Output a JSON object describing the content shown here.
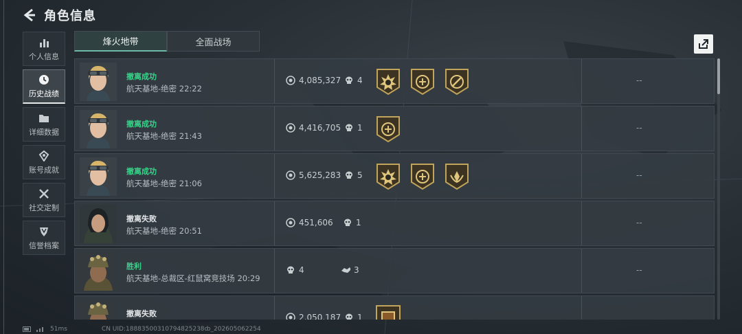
{
  "header": {
    "title": "角色信息"
  },
  "nav": [
    {
      "label": "个人信息",
      "icon": "bar-chart-icon"
    },
    {
      "label": "历史战绩",
      "icon": "clock-icon",
      "active": true
    },
    {
      "label": "详细数据",
      "icon": "folder-icon"
    },
    {
      "label": "账号成就",
      "icon": "trophy-icon"
    },
    {
      "label": "社交定制",
      "icon": "tools-icon"
    },
    {
      "label": "信誉档案",
      "icon": "shield-icon"
    }
  ],
  "tabs": [
    {
      "label": "烽火地带",
      "active": true
    },
    {
      "label": "全面战场",
      "active": false
    }
  ],
  "matches": [
    {
      "result": "撤离成功",
      "status": "ok",
      "map": "航天基地-绝密 22:22",
      "value": "4,085,327",
      "kills": "4",
      "badges": [
        "sun-badge-icon",
        "emblem-badge-icon",
        "compass-badge-icon"
      ],
      "extra": "--",
      "avatar": "female-goggles"
    },
    {
      "result": "撤离成功",
      "status": "ok",
      "map": "航天基地-绝密 21:43",
      "value": "4,416,705",
      "kills": "1",
      "badges": [
        "emblem-badge-icon"
      ],
      "extra": "--",
      "avatar": "female-goggles"
    },
    {
      "result": "撤离成功",
      "status": "ok",
      "map": "航天基地-绝密 21:06",
      "value": "5,625,283",
      "kills": "5",
      "badges": [
        "sun-badge-icon",
        "emblem-badge-icon",
        "wings-badge-icon"
      ],
      "extra": "--",
      "avatar": "female-goggles"
    },
    {
      "result": "撤离失败",
      "status": "fail",
      "map": "航天基地-绝密 20:51",
      "value": "451,606",
      "kills": "1",
      "badges": [],
      "extra": "--",
      "avatar": "female-hood"
    },
    {
      "result": "胜利",
      "status": "ok",
      "map": "航天基地-总裁区-红鼠窝竞技场 20:29",
      "kills": "4",
      "assists": "3",
      "badges": [],
      "extra": "--",
      "avatar": "male-helmet",
      "mode": "arena"
    },
    {
      "result": "撤离失败",
      "status": "fail",
      "map": "",
      "value": "2,050,187",
      "kills": "1",
      "badges": [
        "square-badge-icon"
      ],
      "extra": "",
      "avatar": "male-helmet"
    }
  ],
  "footer": {
    "ping": "51ms",
    "uid": "CN UID:18883500310794825238ȸ_202605062254"
  },
  "colors": {
    "success": "#37d58b",
    "accent_tab": "#6fb9a8"
  }
}
